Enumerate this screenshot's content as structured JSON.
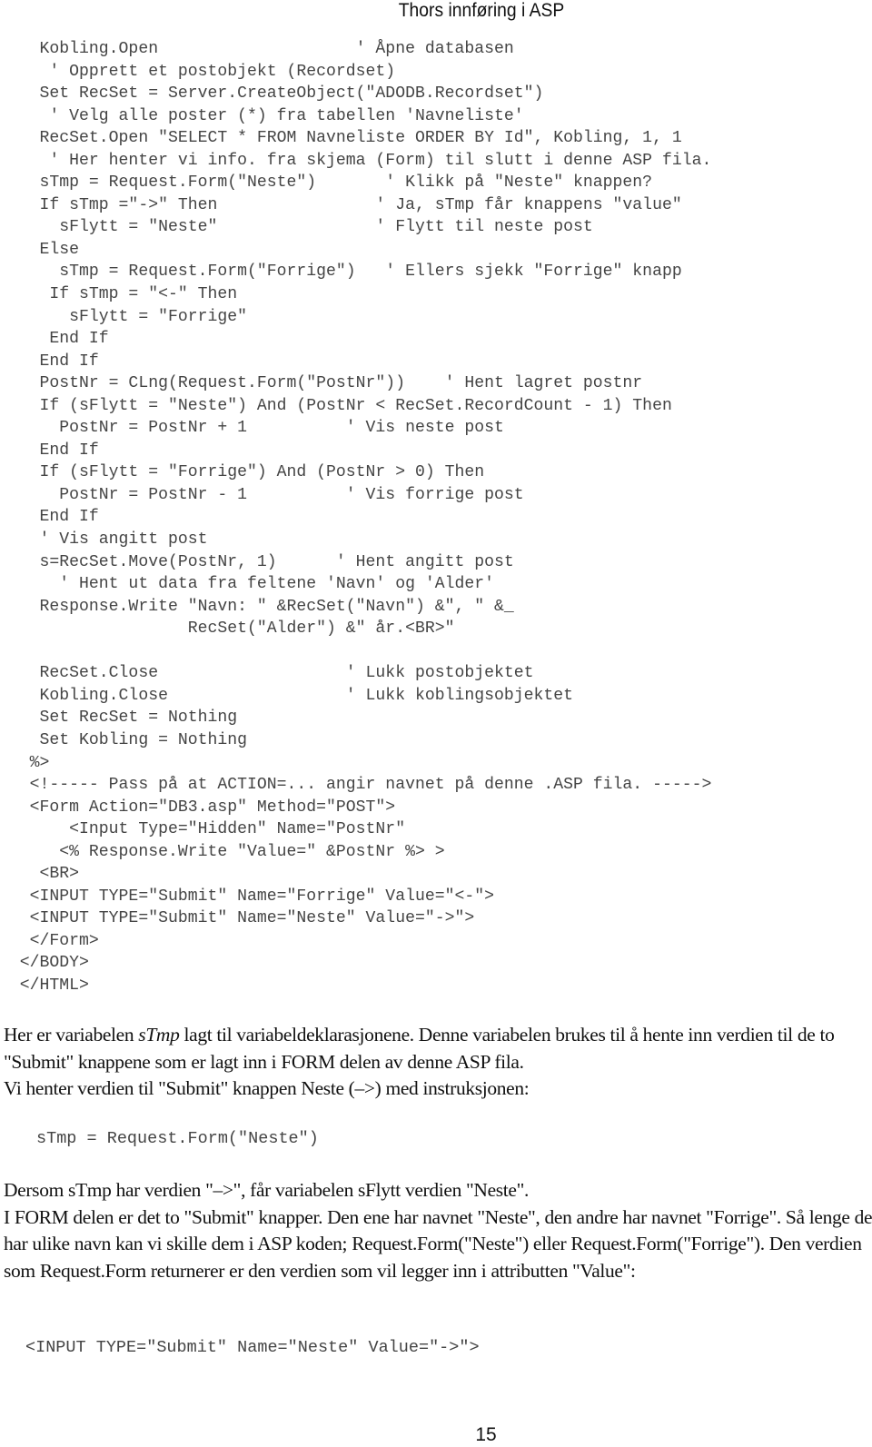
{
  "header": {
    "title": "Thors innføring i ASP"
  },
  "code_block": {
    "lines": [
      "    Kobling.Open                    ' Åpne databasen",
      "     ' Opprett et postobjekt (Recordset)",
      "    Set RecSet = Server.CreateObject(\"ADODB.Recordset\")",
      "     ' Velg alle poster (*) fra tabellen 'Navneliste'",
      "    RecSet.Open \"SELECT * FROM Navneliste ORDER BY Id\", Kobling, 1, 1",
      "     ' Her henter vi info. fra skjema (Form) til slutt i denne ASP fila.",
      "    sTmp = Request.Form(\"Neste\")       ' Klikk på \"Neste\" knappen?",
      "    If sTmp =\"->\" Then                ' Ja, sTmp får knappens \"value\"",
      "      sFlytt = \"Neste\"                ' Flytt til neste post",
      "    Else",
      "      sTmp = Request.Form(\"Forrige\")   ' Ellers sjekk \"Forrige\" knapp",
      "     If sTmp = \"<-\" Then",
      "       sFlytt = \"Forrige\"",
      "     End If",
      "    End If",
      "    PostNr = CLng(Request.Form(\"PostNr\"))    ' Hent lagret postnr",
      "    If (sFlytt = \"Neste\") And (PostNr < RecSet.RecordCount - 1) Then",
      "      PostNr = PostNr + 1          ' Vis neste post",
      "    End If",
      "    If (sFlytt = \"Forrige\") And (PostNr > 0) Then",
      "      PostNr = PostNr - 1          ' Vis forrige post",
      "    End If",
      "    ' Vis angitt post",
      "    s=RecSet.Move(PostNr, 1)      ' Hent angitt post",
      "      ' Hent ut data fra feltene 'Navn' og 'Alder'",
      "    Response.Write \"Navn: \" &RecSet(\"Navn\") &\", \" &_",
      "                   RecSet(\"Alder\") &\" år.<BR>\"",
      "",
      "    RecSet.Close                   ' Lukk postobjektet",
      "    Kobling.Close                  ' Lukk koblingsobjektet",
      "    Set RecSet = Nothing",
      "    Set Kobling = Nothing",
      "   %>",
      "   <!----- Pass på at ACTION=... angir navnet på denne .ASP fila. ----->",
      "   <Form Action=\"DB3.asp\" Method=\"POST\">",
      "       <Input Type=\"Hidden\" Name=\"PostNr\"",
      "      <% Response.Write \"Value=\" &PostNr %> >",
      "    <BR>",
      "   <INPUT TYPE=\"Submit\" Name=\"Forrige\" Value=\"<-\">",
      "   <INPUT TYPE=\"Submit\" Name=\"Neste\" Value=\"->\">",
      "   </Form>",
      "  </BODY>",
      "  </HTML>"
    ]
  },
  "prose": {
    "para1_before_italic": " Her er variabelen ",
    "para1_italic": "sTmp",
    "para1_after_italic": " lagt til variabeldeklarasjonene. Denne variabelen brukes til å hente inn verdien til de to \"Submit\" knappene som er lagt inn i FORM delen av denne ASP fila.",
    "para2": " Vi henter verdien til \"Submit\" knappen Neste (–>) med instruksjonen:",
    "snippet1": "sTmp = Request.Form(\"Neste\")",
    "para3": " Dersom sTmp har verdien \"–>\", får variabelen sFlytt verdien \"Neste\".",
    "para4": " I FORM delen er det to \"Submit\" knapper. Den ene har navnet \"Neste\", den andre har navnet \"Forrige\". Så lenge de har ulike navn kan vi skille dem i ASP koden; Request.Form(\"Neste\") eller Request.Form(\"Forrige\"). Den verdien som Request.Form returnerer er den verdien som vil legger inn i attributten \"Value\":",
    "snippet2": "<INPUT TYPE=\"Submit\" Name=\"Neste\" Value=\"->\">"
  },
  "footer": {
    "page_number": "15"
  }
}
